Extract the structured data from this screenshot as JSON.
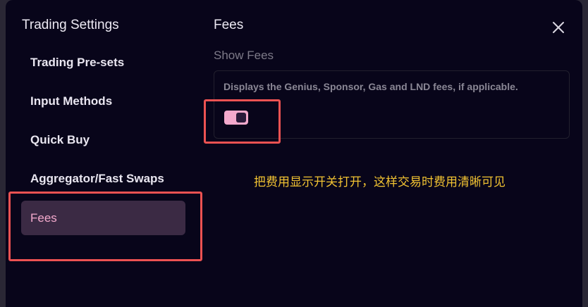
{
  "sidebar": {
    "title": "Trading Settings",
    "items": [
      {
        "label": "Trading Pre-sets",
        "active": false
      },
      {
        "label": "Input Methods",
        "active": false
      },
      {
        "label": "Quick Buy",
        "active": false
      },
      {
        "label": "Aggregator/Fast Swaps",
        "active": false
      },
      {
        "label": "Fees",
        "active": true
      }
    ]
  },
  "main": {
    "title": "Fees",
    "close_icon": "close-icon",
    "setting": {
      "label": "Show Fees",
      "description": "Displays the Genius, Sponsor, Gas and LND fees, if applicable.",
      "toggle_on": true
    }
  },
  "annotation": {
    "text": "把费用显示开关打开，这样交易时费用清晰可见",
    "color": "#f1c232"
  },
  "colors": {
    "accent": "#f3a9cc",
    "highlight": "#ec5252",
    "background": "#08051a"
  }
}
